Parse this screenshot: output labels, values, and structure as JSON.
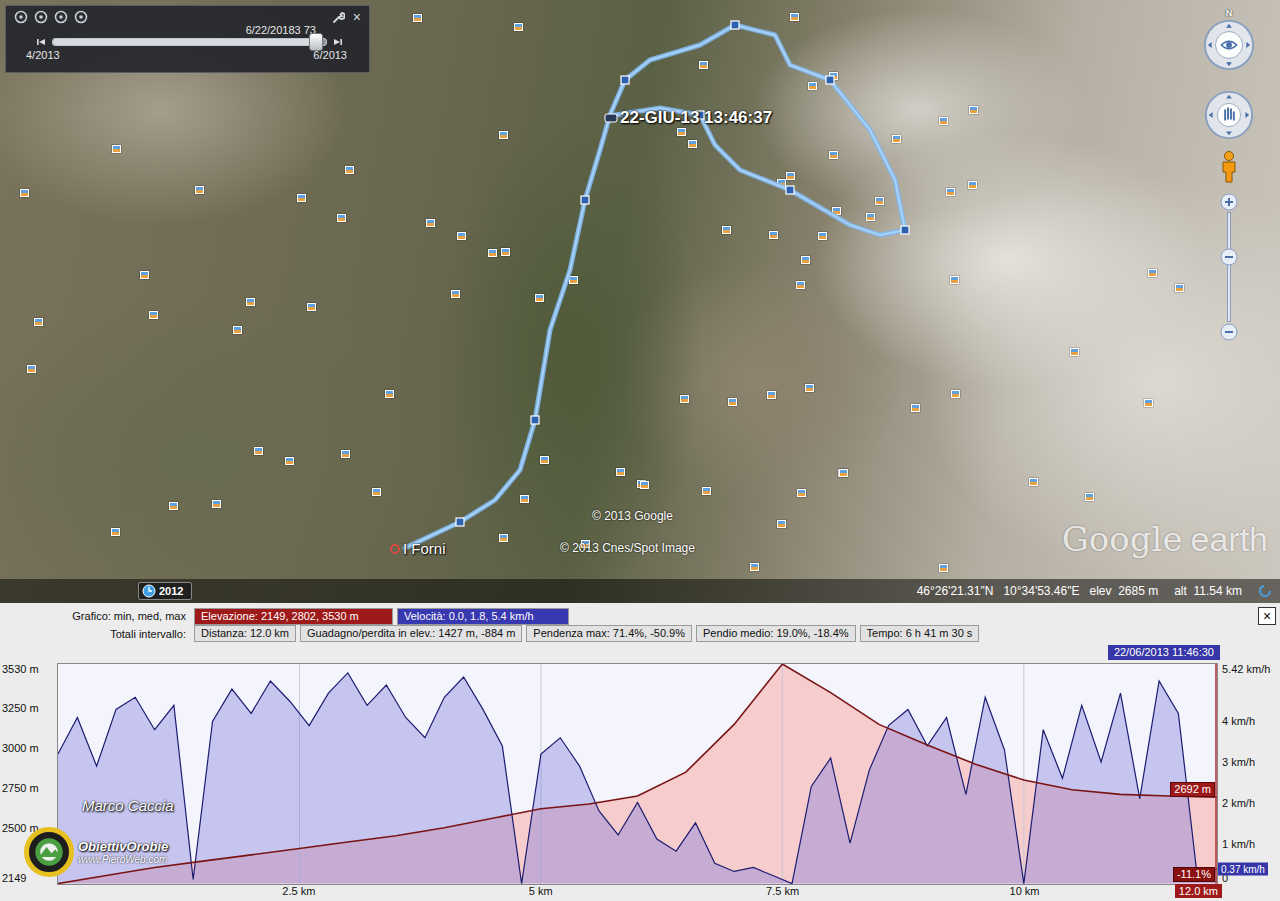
{
  "toolbar": {
    "date_caption": "6/22/20183 73",
    "range_start": "4/2013",
    "range_end": "6/2013",
    "slider_level": 0.96,
    "close": "×"
  },
  "map": {
    "track_label": "22-GIU-13 13:46:37",
    "place": "I Forni",
    "copyright": [
      "© 2013 Google",
      "© 2013 Cnes/Spot Image"
    ],
    "logo": {
      "brand": "Google",
      "product": "earth"
    },
    "imagery_year": "2012",
    "compass": "N"
  },
  "status_bar": {
    "coords": "46°26'21.31\"N   10°34'53.46\"E   elev  2685 m",
    "altitude": "alt  11.54 km"
  },
  "chart": {
    "header": {
      "caption": "Grafico: min, med, max",
      "elevation_summary": "Elevazione: 2149, 2802, 3530 m",
      "speed_summary": "Velocità: 0.0, 1.8, 5.4 km/h",
      "totals_caption": "Totali intervallo:",
      "totals": [
        "Distanza: 12.0 km",
        "Guadagno/perdita in elev.: 1427 m, -884 m",
        "Pendenza max: 71.4%, -50.9%",
        "Pendio medio: 19.0%, -18.4%",
        "Tempo: 6 h 41 m 30 s"
      ],
      "close": "×"
    },
    "timestamp": "22/06/2013 11:46:30",
    "y_left_ticks": [
      {
        "label": "3530 m",
        "value": 3530
      },
      {
        "label": "3250 m",
        "value": 3250
      },
      {
        "label": "3000 m",
        "value": 3000
      },
      {
        "label": "2750 m",
        "value": 2750
      },
      {
        "label": "2500 m",
        "value": 2500
      },
      {
        "label": "2149",
        "value": 2149
      }
    ],
    "y_right_ticks": [
      {
        "label": "5.42 km/h",
        "value": 5.42
      },
      {
        "label": "4 km/h",
        "value": 4
      },
      {
        "label": "3 km/h",
        "value": 3
      },
      {
        "label": "2 km/h",
        "value": 2
      },
      {
        "label": "1 km/h",
        "value": 1
      },
      {
        "label": "0",
        "value": 0
      }
    ],
    "x_ticks": [
      {
        "label": "2.5 km",
        "value": 2.5
      },
      {
        "label": "5 km",
        "value": 5
      },
      {
        "label": "7.5 km",
        "value": 7.5
      },
      {
        "label": "10 km",
        "value": 10
      }
    ],
    "x_end": "12.0 km",
    "distance_km": 12,
    "elevation": [
      2149,
      2200,
      2250,
      2290,
      2330,
      2370,
      2410,
      2450,
      2500,
      2560,
      2620,
      2650,
      2700,
      2850,
      3150,
      3530,
      3350,
      3150,
      3020,
      2900,
      2800,
      2740,
      2710,
      2700,
      2692
    ],
    "speed": [
      3.2,
      4.1,
      2.9,
      4.3,
      4.6,
      3.8,
      4.4,
      0.1,
      4.0,
      4.8,
      4.2,
      5.0,
      4.5,
      3.9,
      4.7,
      5.2,
      4.4,
      4.9,
      4.1,
      3.6,
      4.6,
      5.1,
      4.3,
      3.4,
      0.0,
      3.2,
      3.6,
      2.9,
      1.8,
      1.2,
      2.0,
      1.1,
      0.8,
      1.5,
      0.5,
      0.3,
      0.4,
      0.2,
      0.0,
      2.4,
      3.1,
      1.0,
      2.8,
      3.9,
      4.3,
      3.4,
      4.1,
      2.2,
      4.6,
      3.3,
      0.0,
      3.8,
      2.6,
      4.4,
      3.0,
      4.7,
      2.1,
      5.0,
      4.2,
      0.1,
      0.37
    ],
    "readouts": {
      "elevation": "2692 m",
      "slope": "-11.1%",
      "speed": "0.37 km/h"
    }
  },
  "watermark": {
    "author": "Marco Caccia",
    "brand": "ObiettivOrobie",
    "site": "www.PieroWeb.com"
  }
}
